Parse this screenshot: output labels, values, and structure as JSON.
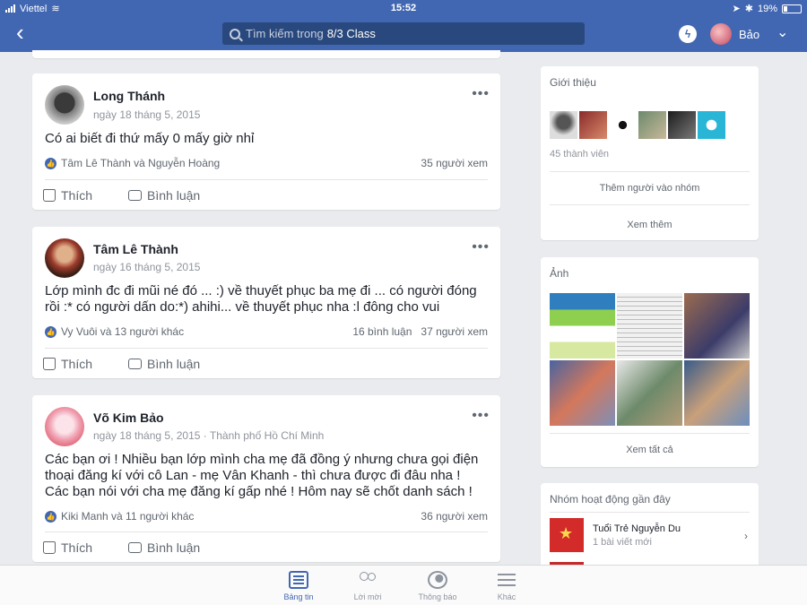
{
  "status_bar": {
    "carrier": "Viettel",
    "time": "15:52",
    "battery": "19%"
  },
  "nav": {
    "search_prefix": "Tìm kiếm trong",
    "search_group": "8/3 Class",
    "user_name": "Bảo",
    "icons": {
      "back": "back-arrow-icon",
      "messenger": "messenger-icon",
      "dropdown": "chevron-down-icon"
    }
  },
  "posts": [
    {
      "author": "Long Thánh",
      "date": "ngày 18 tháng 5, 2015",
      "location": "",
      "text": "Có ai biết đi thứ mấy 0 mấy giờ nhỉ",
      "reactors": "Tâm Lê Thành và Nguyễn Hoàng",
      "comments": "",
      "views": "35 người xem",
      "like_label": "Thích",
      "comment_label": "Bình luận"
    },
    {
      "author": "Tâm Lê Thành",
      "date": "ngày 16 tháng 5, 2015",
      "location": "",
      "text": "Lớp mình đc đi mũi né đó ... :) về thuyết phục ba mẹ đi ... có người đóng rồi :* có người dấn do:*) ahihi... về thuyết phục nha :l đông cho vui",
      "reactors": "Vy Vuôi và 13 người khác",
      "comments": "16 bình luận",
      "views": "37 người xem",
      "like_label": "Thích",
      "comment_label": "Bình luận"
    },
    {
      "author": "Võ Kim Bảo",
      "date": "ngày 18 tháng 5, 2015",
      "location": "· Thành phố Hồ Chí Minh",
      "text": "Các bạn ơi ! Nhiều bạn lớp mình cha mẹ đã đồng ý nhưng chưa gọi điện thoại đăng kí với cô Lan - mẹ Vân Khanh - thì chưa được đi đâu nha ! Các bạn nói với cha mẹ đăng kí gấp nhé ! Hôm nay sẽ chốt danh sách !",
      "reactors": "Kiki Manh và 11 người khác",
      "comments": "",
      "views": "36 người xem",
      "like_label": "Thích",
      "comment_label": "Bình luận"
    }
  ],
  "about": {
    "title": "Giới thiệu",
    "member_count": "45 thành viên",
    "add_members": "Thêm người vào nhóm",
    "see_more": "Xem thêm"
  },
  "photos": {
    "title": "Ảnh",
    "see_all": "Xem tất cả"
  },
  "recent_groups": {
    "title": "Nhóm hoạt động gần đây",
    "items": [
      {
        "name": "Tuổi Trẻ Nguyễn Du",
        "sub": "1 bài viết mới"
      }
    ]
  },
  "tabbar": {
    "feed": "Bảng tin",
    "friends": "Lời mời",
    "notifications": "Thông báo",
    "more": "Khác"
  },
  "colors": {
    "brand": "#4267b2",
    "background": "#e9ebee"
  }
}
